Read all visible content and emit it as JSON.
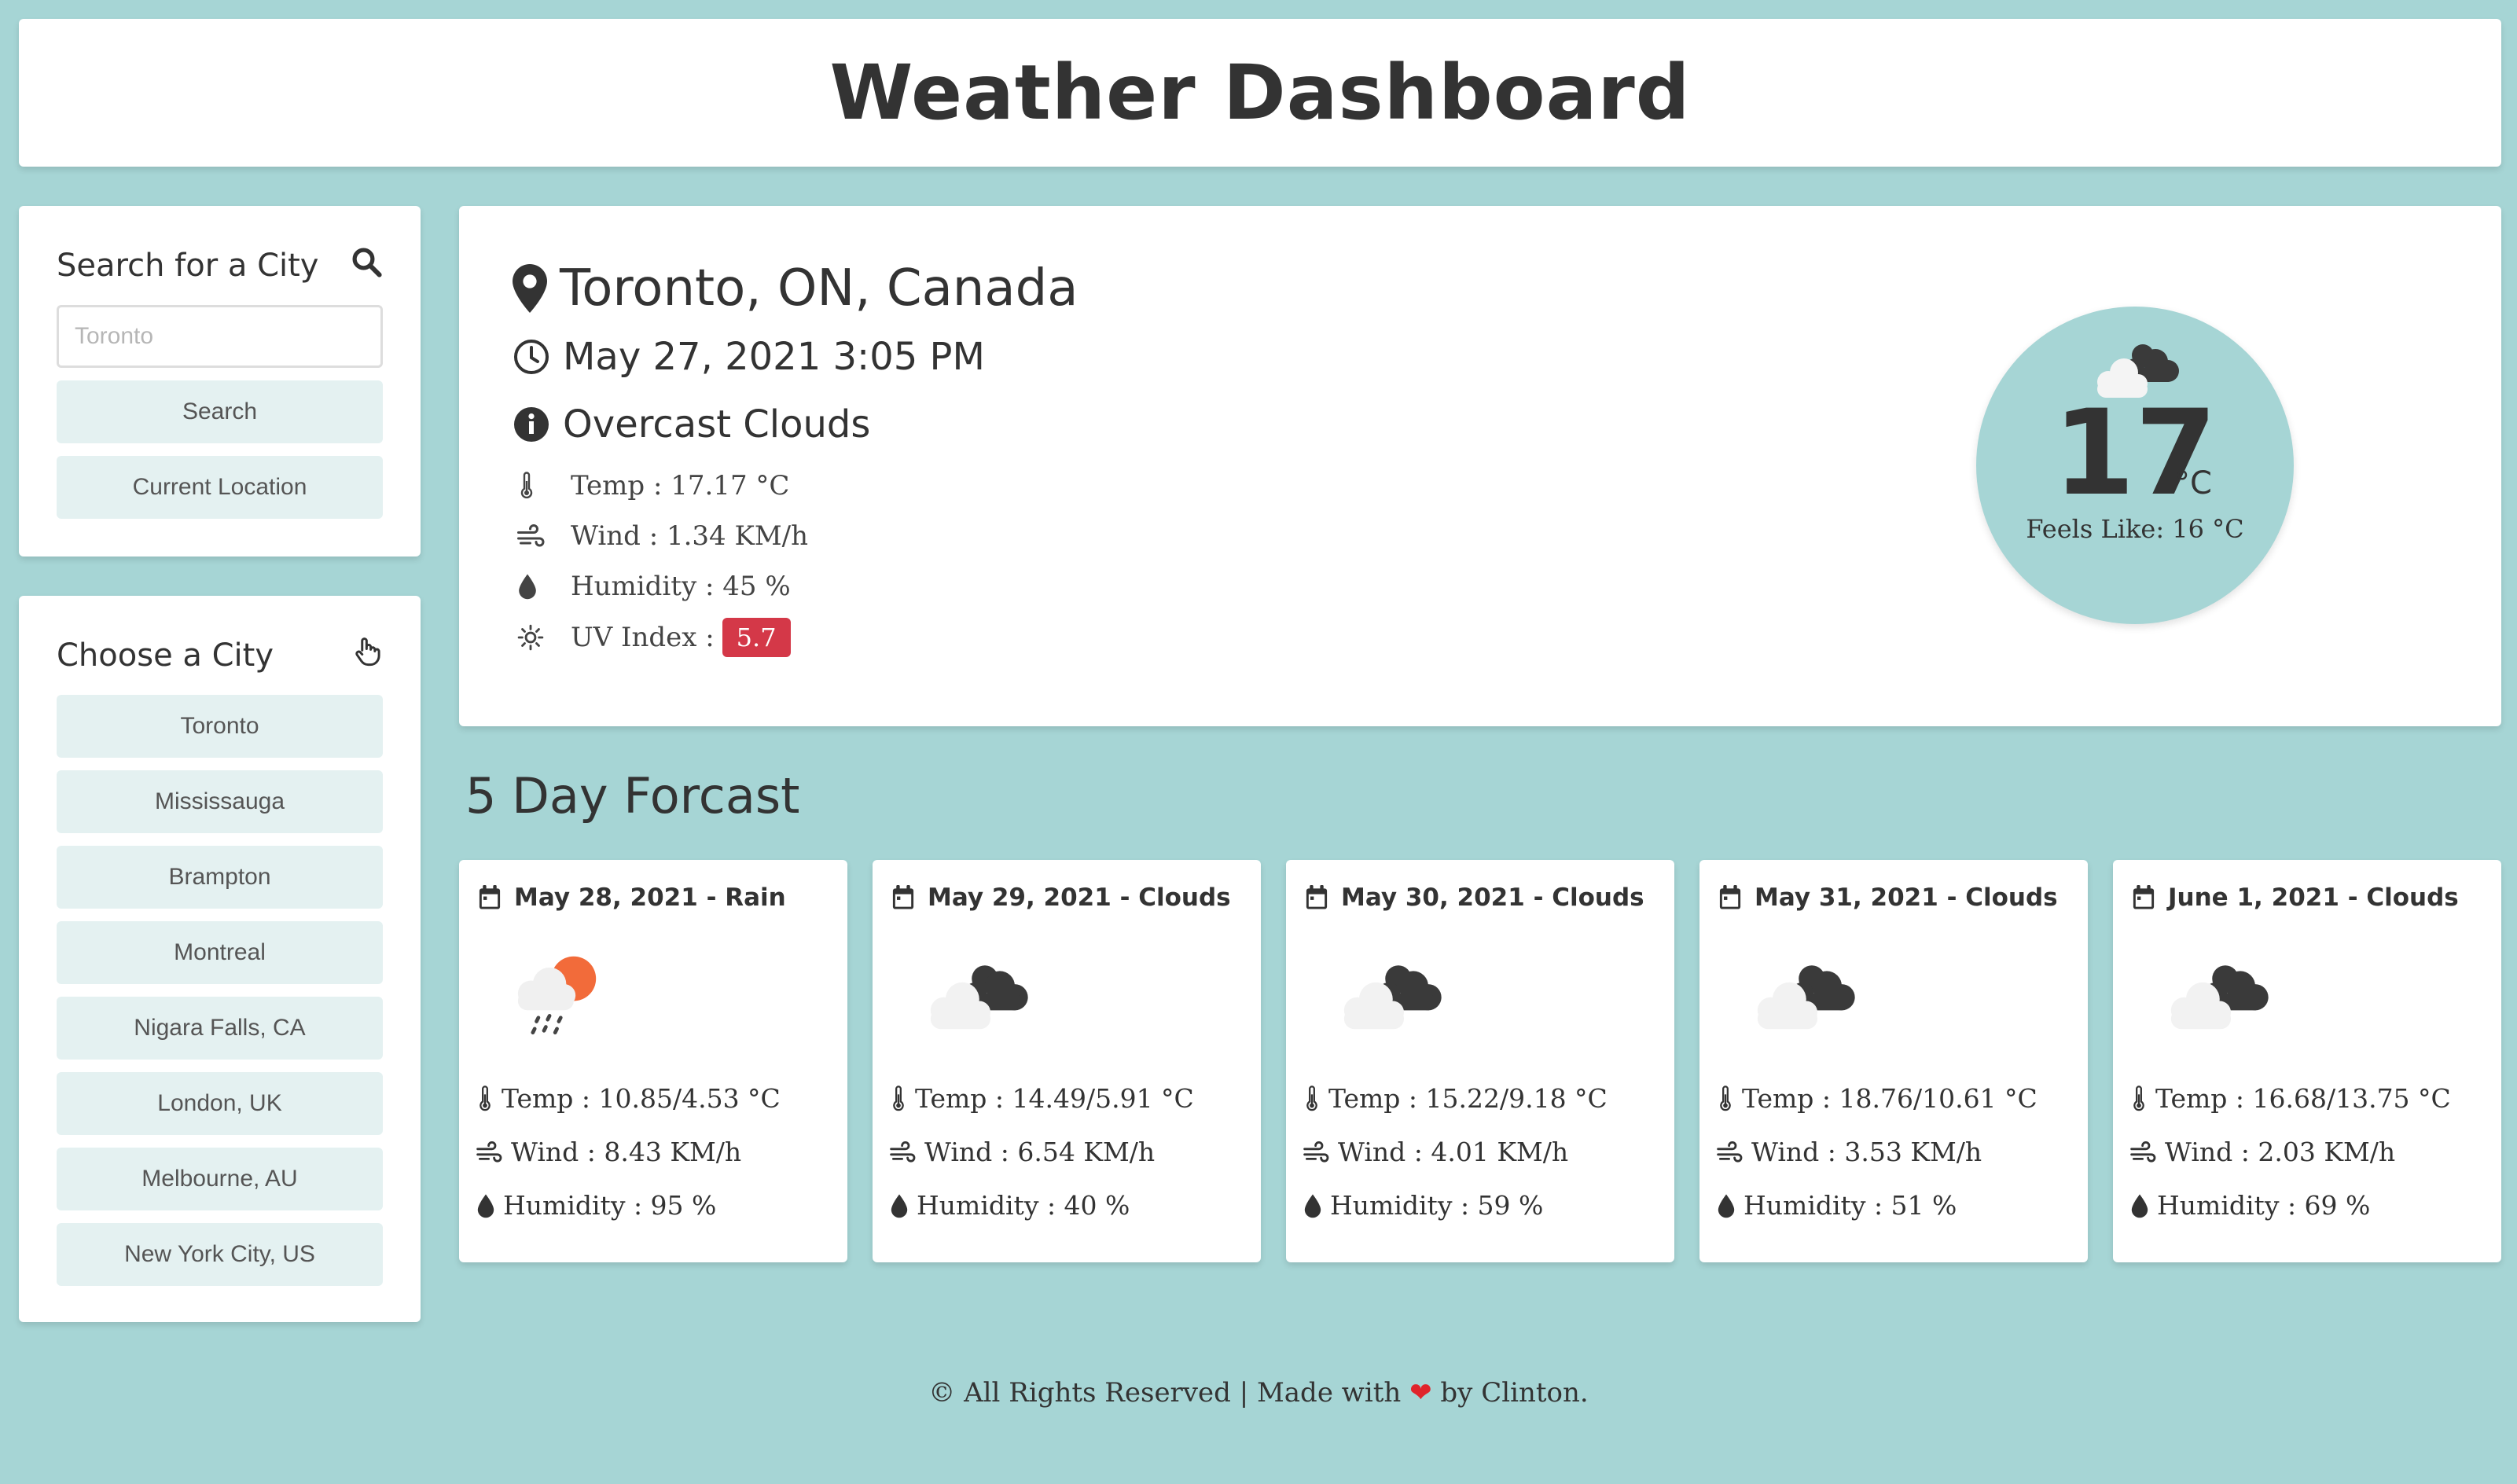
{
  "header": {
    "title": "Weather Dashboard"
  },
  "search": {
    "title": "Search for a City",
    "placeholder": "Toronto",
    "search_label": "Search",
    "location_label": "Current Location"
  },
  "choose": {
    "title": "Choose a City",
    "cities": [
      "Toronto",
      "Mississauga",
      "Brampton",
      "Montreal",
      "Nigara Falls, CA",
      "London, UK",
      "Melbourne, AU",
      "New York City, US"
    ]
  },
  "current": {
    "location": "Toronto, ON, Canada",
    "datetime": "May 27, 2021 3:05 PM",
    "condition": "Overcast Clouds",
    "temp": "Temp : 17.17 °C",
    "wind": "Wind : 1.34 KM/h",
    "humidity": "Humidity : 45 %",
    "uv_label": "UV Index :",
    "uv_value": "5.7",
    "uv_color": "#d43848",
    "temp_big": "17",
    "temp_unit": "°C",
    "feels_like": "Feels Like: 16 °C",
    "icon": "overcast-clouds-icon"
  },
  "forecast": {
    "title": "5 Day Forcast",
    "days": [
      {
        "date": "May 28, 2021 - Rain",
        "icon": "rain-sun-icon",
        "temp": "Temp : 10.85/4.53 °C",
        "wind": "Wind : 8.43 KM/h",
        "humidity": "Humidity : 95 %"
      },
      {
        "date": "May 29, 2021 - Clouds",
        "icon": "clouds-icon",
        "temp": "Temp : 14.49/5.91 °C",
        "wind": "Wind : 6.54 KM/h",
        "humidity": "Humidity : 40 %"
      },
      {
        "date": "May 30, 2021 - Clouds",
        "icon": "clouds-icon",
        "temp": "Temp : 15.22/9.18 °C",
        "wind": "Wind : 4.01 KM/h",
        "humidity": "Humidity : 59 %"
      },
      {
        "date": "May 31, 2021 - Clouds",
        "icon": "clouds-icon",
        "temp": "Temp : 18.76/10.61 °C",
        "wind": "Wind : 3.53 KM/h",
        "humidity": "Humidity : 51 %"
      },
      {
        "date": "June 1, 2021 - Clouds",
        "icon": "clouds-icon",
        "temp": "Temp : 16.68/13.75 °C",
        "wind": "Wind : 2.03 KM/h",
        "humidity": "Humidity : 69 %"
      }
    ]
  },
  "footer": {
    "before": "© All Rights Reserved | Made with",
    "heart": "❤",
    "after": "by Clinton."
  }
}
